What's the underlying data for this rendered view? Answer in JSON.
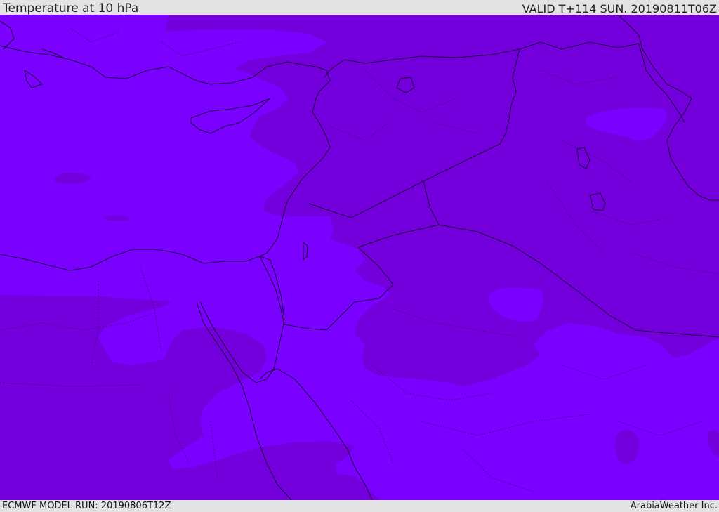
{
  "header": {
    "title": "Temperature at 10 hPa",
    "valid": "VALID T+114 SUN. 20190811T06Z"
  },
  "footer": {
    "model_run": "ECMWF MODEL RUN: 20190806T12Z",
    "credit": "ArabiaWeather Inc."
  },
  "colors": {
    "warmer_band": "#7a00ff",
    "cooler_band": "#7300dc",
    "bar_background": "#e3e3e3",
    "lines": "#1c0536"
  },
  "map": {
    "field": "temperature",
    "level": "10 hPa",
    "region": "Eastern Mediterranean, Levant and Arabian Peninsula"
  }
}
